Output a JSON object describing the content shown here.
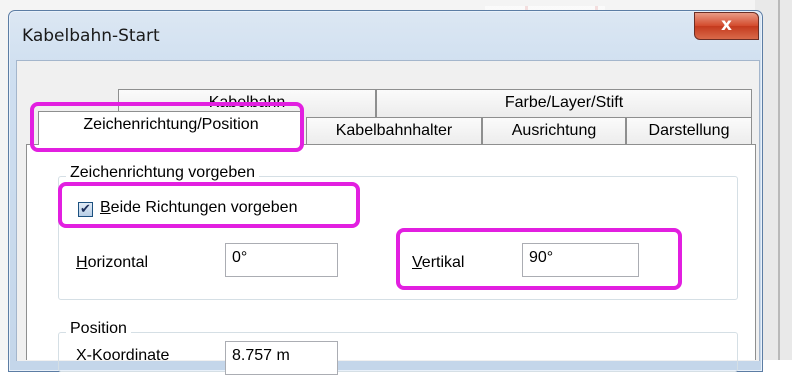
{
  "window": {
    "title": "Kabelbahn-Start",
    "close_label": "x"
  },
  "tabs": {
    "row_back": [
      "Kabelbahn",
      "Farbe/Layer/Stift"
    ],
    "row_front": [
      "Zeichenrichtung/Position",
      "Kabelbahnhalter",
      "Ausrichtung",
      "Darstellung"
    ],
    "selected": "Zeichenrichtung/Position"
  },
  "direction_group": {
    "title": "Zeichenrichtung vorgeben",
    "checkbox_label": "Beide Richtungen vorgeben",
    "checkbox_mnemonic": "B",
    "checked": true,
    "horizontal_label_mn": "H",
    "horizontal_label_rest": "orizontal",
    "horizontal_value": "0°",
    "vertical_label_mn": "V",
    "vertical_label_rest": "ertikal",
    "vertical_value": "90°"
  },
  "position_group": {
    "title": "Position",
    "x_label": "X-Koordinate",
    "x_value": "8.757 m"
  },
  "colors": {
    "highlight": "#e21fe0",
    "close_button": "#d34a2c"
  }
}
